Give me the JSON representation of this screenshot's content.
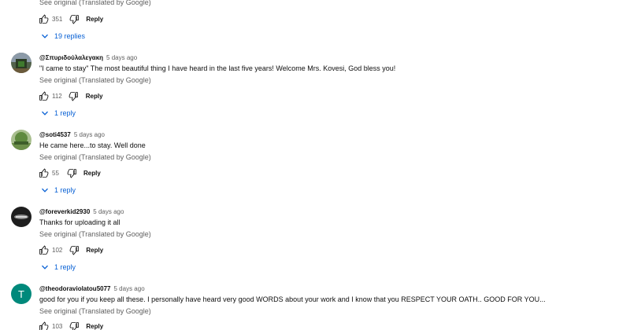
{
  "top_comment_tail": {
    "see_original": "See original (Translated by Google)",
    "likes": "351",
    "reply_label": "Reply",
    "replies_toggle": "19 replies"
  },
  "comments": [
    {
      "handle": "@Σπυριδούλαλεγακη",
      "time": "5 days ago",
      "text": "\"I came to stay\" The most beautiful thing I have heard in the last five years! Welcome Mrs. Kovesi, God bless you!",
      "see_original": "See original (Translated by Google)",
      "likes": "112",
      "reply_label": "Reply",
      "replies_toggle": "1 reply",
      "avatar_colors": [
        "#6b7a5a",
        "#2f3a2a"
      ]
    },
    {
      "handle": "@soti4537",
      "time": "5 days ago",
      "text": "He came here...to stay. Well done",
      "see_original": "See original (Translated by Google)",
      "likes": "55",
      "reply_label": "Reply",
      "replies_toggle": "1 reply",
      "avatar_colors": [
        "#7e9a5e",
        "#4d6a3b"
      ]
    },
    {
      "handle": "@foreverkid2930",
      "time": "5 days ago",
      "text": "Thanks for uploading it all",
      "see_original": "See original (Translated by Google)",
      "likes": "102",
      "reply_label": "Reply",
      "replies_toggle": "1 reply",
      "avatar_colors": [
        "#3b3b3b",
        "#111111"
      ]
    },
    {
      "handle": "@theodoraviolatou5077",
      "time": "5 days ago",
      "text": "good for you if you keep all these. I personally have heard very good WORDS about your work and I know that you RESPECT YOUR OATH.. GOOD FOR YOU...",
      "see_original": "See original (Translated by Google)",
      "likes": "103",
      "reply_label": "Reply",
      "avatar_letter": "T",
      "avatar_colors": [
        "#00897b",
        "#00897b"
      ]
    }
  ],
  "colors": {
    "link_blue": "#065fd4",
    "meta_gray": "#606060",
    "text_dark": "#0f0f0f"
  },
  "icons": {
    "like": "thumbs-up-icon",
    "dislike": "thumbs-down-icon",
    "expand": "chevron-down-icon"
  }
}
